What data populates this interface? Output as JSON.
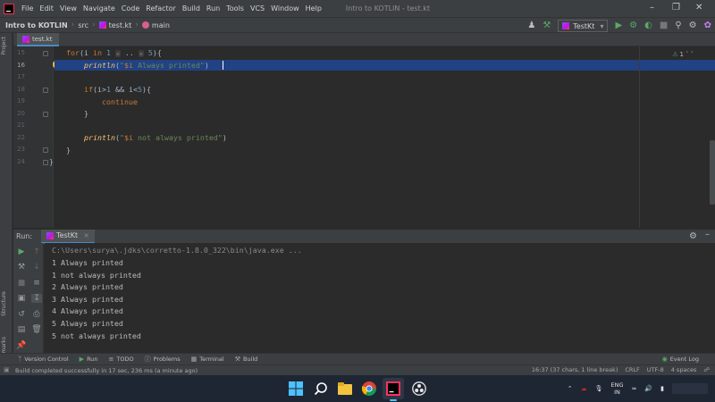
{
  "menu": {
    "items": [
      "File",
      "Edit",
      "View",
      "Navigate",
      "Code",
      "Refactor",
      "Build",
      "Run",
      "Tools",
      "VCS",
      "Window",
      "Help"
    ],
    "window_title": "Intro to KOTLIN - test.kt"
  },
  "navbar": {
    "project": "Intro to KOTLIN",
    "folder": "src",
    "file": "test.kt",
    "function": "main",
    "run_config": "TestKt"
  },
  "sidebar": {
    "project_label": "Project",
    "structure_label": "Structure",
    "bookmarks_label": "Bookmarks"
  },
  "editor": {
    "tab": "test.kt",
    "inspection_count": "1",
    "lines": [
      {
        "no": "15"
      },
      {
        "no": "16"
      },
      {
        "no": "17"
      },
      {
        "no": "18"
      },
      {
        "no": "19"
      },
      {
        "no": "20"
      },
      {
        "no": "21"
      },
      {
        "no": "22"
      },
      {
        "no": "23"
      },
      {
        "no": "24"
      }
    ],
    "code": {
      "l15_kw": "for",
      "l15_var": "(i ",
      "l15_in": "in",
      "l15_start": "1",
      "l15_hint1": "≤",
      "l15_range": " .. ",
      "l15_hint2": "≤",
      "l15_end": "5",
      "l15_tail": "){",
      "l16_fn": "println",
      "l16_open": "(",
      "l16_tmpl": "$i",
      "l16_str": " Always printed\"",
      "l16_q": "\"",
      "l16_close": ")",
      "l18_kw": "if",
      "l18_cond_a": "(i>",
      "l18_n1": "1",
      "l18_cond_b": " && i<",
      "l18_n2": "5",
      "l18_tail": "){",
      "l19_kw": "continue",
      "l20": "}",
      "l22_fn": "println",
      "l22_open": "(",
      "l22_q": "\"",
      "l22_tmpl": "$i",
      "l22_str": " not always printed\"",
      "l22_close": ")",
      "l23": "}",
      "l24": "}"
    }
  },
  "run_panel": {
    "label": "Run:",
    "tab": "TestKt",
    "console": [
      "C:\\Users\\surya\\.jdks\\corretto-1.8.0_322\\bin\\java.exe ...",
      "1 Always printed",
      "1 not always printed",
      "2 Always printed",
      "3 Always printed",
      "4 Always printed",
      "5 Always printed",
      "5 not always printed"
    ]
  },
  "toolwindows": {
    "version_control": "Version Control",
    "run": "Run",
    "todo": "TODO",
    "problems": "Problems",
    "terminal": "Terminal",
    "build": "Build",
    "event_log": "Event Log"
  },
  "status": {
    "message": "Build completed successfully in 17 sec, 236 ms (a minute ago)",
    "position": "16:37 (37 chars, 1 line break)",
    "line_sep": "CRLF",
    "encoding": "UTF-8",
    "indent": "4 spaces"
  },
  "taskbar": {
    "lang_top": "ENG",
    "lang_bottom": "IN"
  },
  "colors": {
    "keyword": "#cc7832",
    "number": "#6897bb",
    "string": "#6a8759",
    "function": "#ffc66d",
    "selection": "#214283",
    "run_green": "#59a869"
  }
}
